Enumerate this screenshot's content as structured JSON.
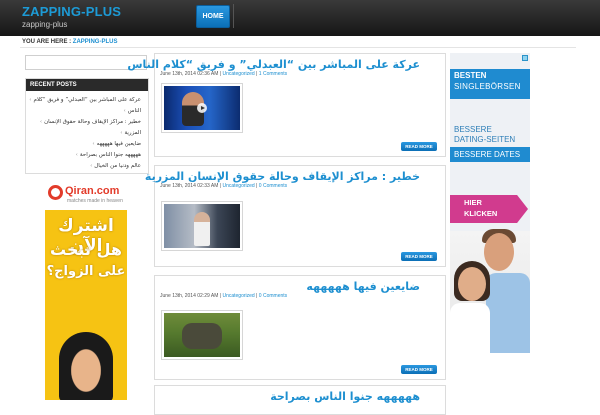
{
  "site": {
    "title": "ZAPPING-PLUS",
    "tagline": "zapping-plus"
  },
  "nav": {
    "home_label": "HOME"
  },
  "breadcrumb": {
    "prefix": "YOU ARE HERE :",
    "current": "ZAPPING-PLUS"
  },
  "sidebar": {
    "recent_title": "RECENT POSTS",
    "recent_posts": [
      "عركة على المباشر بين “العبدلي” و فريق “كلام",
      "الناس",
      "خطير : مراكز الإيقاف وحالة حقوق الإنسان",
      "المزرية",
      "ضايعين فيها هههههه",
      "هههههه جنوا الناس بصراحة",
      "عالم ودنيا من الخيال"
    ]
  },
  "ad_left": {
    "brand": "Qiran.com",
    "brand_tagline": "matches made in heaven",
    "line1": "اشترك الآن",
    "line2": "هل تبحث",
    "line3": "على الزواج؟"
  },
  "ad_right": {
    "headline1": "BESTEN",
    "headline2": "SINGLEBÖRSEN",
    "line1": "BESSERE",
    "line2": "DATING-SEITEN",
    "line3": "BESSERE DATES",
    "cta1": "HIER",
    "cta2": "KLICKEN"
  },
  "posts": [
    {
      "title": "عركة على المباشر بين “العبدلي” و فريق “كلام الناس",
      "date": "June 13th, 2014 02:36 AM",
      "category": "Uncategorized",
      "comments": "1 Comments",
      "read_more": "READ MORE"
    },
    {
      "title": "خطير : مراكز الإيقاف وحالة حقوق الإنسان المزرية",
      "date": "June 13th, 2014 02:33 AM",
      "category": "Uncategorized",
      "comments": "0 Comments",
      "read_more": "READ MORE"
    },
    {
      "title": "ضايعين فيها هههههه",
      "date": "June 13th, 2014 02:29 AM",
      "category": "Uncategorized",
      "comments": "0 Comments",
      "read_more": "READ MORE"
    },
    {
      "title": "هههههه جنوا الناس بصراحة"
    }
  ],
  "meta_sep": " | "
}
